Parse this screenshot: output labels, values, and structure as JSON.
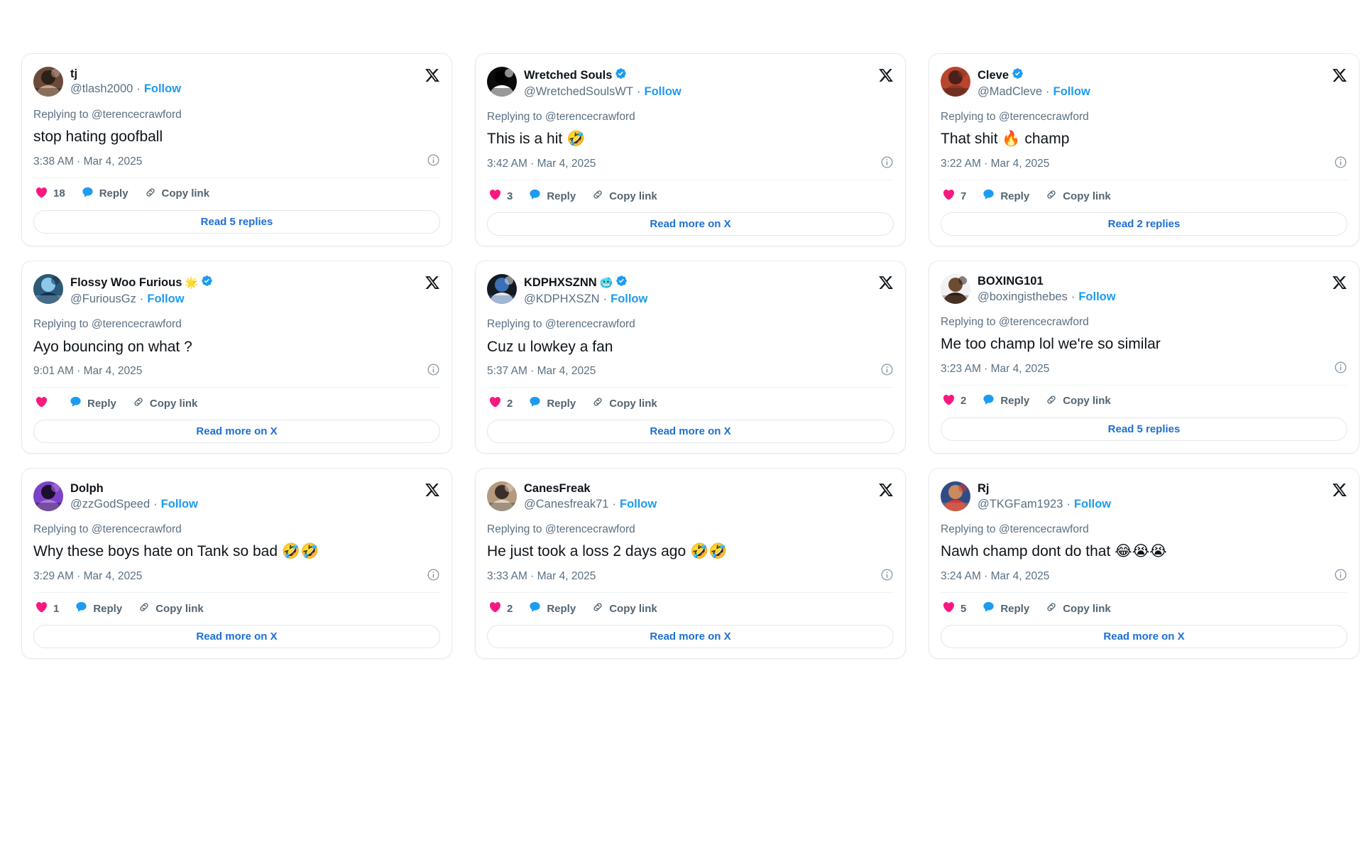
{
  "colors": {
    "accent_blue": "#1d9bf0",
    "link_blue": "#1d6fd4",
    "heart_pink": "#f91880",
    "verified_blue": "#1d9bf0",
    "text_primary": "#0f1419",
    "text_secondary": "#5b7083",
    "card_border": "#e8e8e8",
    "page_bg": "#ffffff"
  },
  "labels": {
    "reply": "Reply",
    "copy_link": "Copy link",
    "follow": "Follow",
    "separator": "·"
  },
  "cards": [
    {
      "display_name": "tj",
      "name_emoji": "",
      "verified": false,
      "handle": "@tlash2000",
      "follow_label": "Follow",
      "replying_to": "Replying to @terencecrawford",
      "text": "stop hating goofball",
      "timestamp": "3:38 AM · Mar 4, 2025",
      "like_count": "18",
      "reply_label": "Reply",
      "copy_label": "Copy link",
      "footer_label": "Read 5 replies",
      "avatar_colors": [
        "#6b4a3a",
        "#2b2119",
        "#c6a48a"
      ]
    },
    {
      "display_name": "Wretched Souls",
      "name_emoji": "",
      "verified": true,
      "handle": "@WretchedSoulsWT",
      "follow_label": "Follow",
      "replying_to": "Replying to @terencecrawford",
      "text": "This is a hit 🤣",
      "timestamp": "3:42 AM · Mar 4, 2025",
      "like_count": "3",
      "reply_label": "Reply",
      "copy_label": "Copy link",
      "footer_label": "Read more on X",
      "avatar_colors": [
        "#0b0b0b",
        "#000000",
        "#ffffff"
      ]
    },
    {
      "display_name": "Cleve",
      "name_emoji": "",
      "verified": true,
      "handle": "@MadCleve",
      "follow_label": "Follow",
      "replying_to": "Replying to @terencecrawford",
      "text": "That shit 🔥 champ",
      "timestamp": "3:22 AM · Mar 4, 2025",
      "like_count": "7",
      "reply_label": "Reply",
      "copy_label": "Copy link",
      "footer_label": "Read 2 replies",
      "avatar_colors": [
        "#b9452e",
        "#4a2118",
        "#8d3a26"
      ]
    },
    {
      "display_name": "Flossy Woo Furious",
      "name_emoji": "🌟",
      "verified": true,
      "handle": "@FuriousGz",
      "follow_label": "Follow",
      "replying_to": "Replying to @terencecrawford",
      "text": "Ayo bouncing on what ?",
      "timestamp": "9:01 AM · Mar 4, 2025",
      "like_count": "",
      "reply_label": "Reply",
      "copy_label": "Copy link",
      "footer_label": "Read more on X",
      "avatar_colors": [
        "#2c5a77",
        "#8fc7e8",
        "#14304a"
      ]
    },
    {
      "display_name": "KDPHXSZNN",
      "name_emoji": "🥶",
      "verified": true,
      "handle": "@KDPHXSZN",
      "follow_label": "Follow",
      "replying_to": "Replying to @terencecrawford",
      "text": "Cuz u lowkey a fan",
      "timestamp": "5:37 AM · Mar 4, 2025",
      "like_count": "2",
      "reply_label": "Reply",
      "copy_label": "Copy link",
      "footer_label": "Read more on X",
      "avatar_colors": [
        "#151a22",
        "#3c6fb5",
        "#e5e7ea"
      ]
    },
    {
      "display_name": "BOXING101",
      "name_emoji": "",
      "verified": false,
      "handle": "@boxingisthebes",
      "follow_label": "Follow",
      "replying_to": "Replying to @terencecrawford",
      "text": "Me too champ lol we're so similar",
      "timestamp": "3:23 AM · Mar 4, 2025",
      "like_count": "2",
      "reply_label": "Reply",
      "copy_label": "Copy link",
      "footer_label": "Read 5 replies",
      "avatar_colors": [
        "#f2f2f2",
        "#6e4b33",
        "#2e2019"
      ]
    },
    {
      "display_name": "Dolph",
      "name_emoji": "",
      "verified": false,
      "handle": "@zzGodSpeed",
      "follow_label": "Follow",
      "replying_to": "Replying to @terencecrawford",
      "text": "Why these boys hate on Tank so bad 🤣🤣",
      "timestamp": "3:29 AM · Mar 4, 2025",
      "like_count": "1",
      "reply_label": "Reply",
      "copy_label": "Copy link",
      "footer_label": "Read more on X",
      "avatar_colors": [
        "#7b42c9",
        "#1b0f2e",
        "#b07ae8"
      ]
    },
    {
      "display_name": "CanesFreak",
      "name_emoji": "",
      "verified": false,
      "handle": "@Canesfreak71",
      "follow_label": "Follow",
      "replying_to": "Replying to @terencecrawford",
      "text": "He just took a loss 2 days ago 🤣🤣",
      "timestamp": "3:33 AM · Mar 4, 2025",
      "like_count": "2",
      "reply_label": "Reply",
      "copy_label": "Copy link",
      "footer_label": "Read more on X",
      "avatar_colors": [
        "#b79a7c",
        "#3a3029",
        "#e3d2bd"
      ]
    },
    {
      "display_name": "Rj",
      "name_emoji": "",
      "verified": false,
      "handle": "@TKGFam1923",
      "follow_label": "Follow",
      "replying_to": "Replying to @terencecrawford",
      "text": "Nawh champ dont do that 😂😭😭",
      "timestamp": "3:24 AM · Mar 4, 2025",
      "like_count": "5",
      "reply_label": "Reply",
      "copy_label": "Copy link",
      "footer_label": "Read more on X",
      "avatar_colors": [
        "#2e4d86",
        "#c98a5e",
        "#d33b3b"
      ]
    }
  ]
}
